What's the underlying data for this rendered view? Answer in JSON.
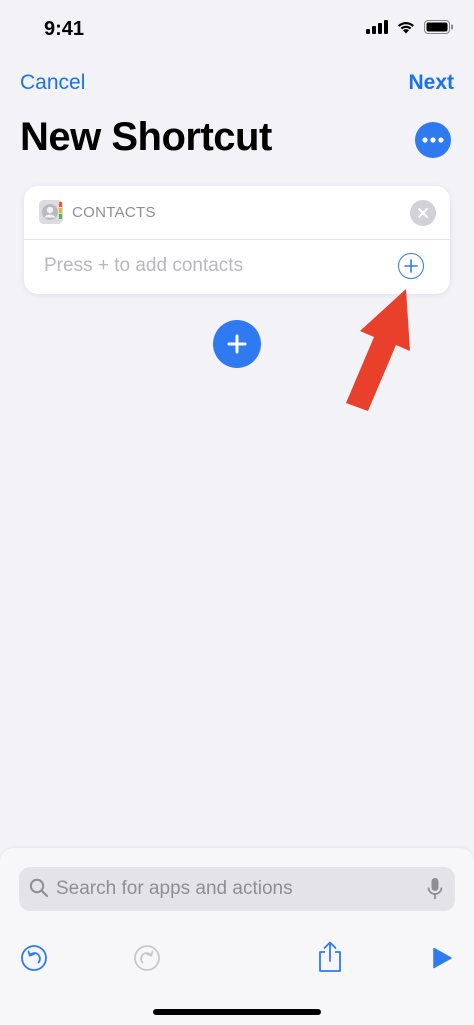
{
  "status_bar": {
    "time": "9:41"
  },
  "nav": {
    "cancel_label": "Cancel",
    "next_label": "Next"
  },
  "page": {
    "title": "New Shortcut"
  },
  "action_card": {
    "title": "CONTACTS",
    "placeholder": "Press + to add contacts"
  },
  "search": {
    "placeholder": "Search for apps and actions"
  },
  "colors": {
    "accent": "#2f7af0",
    "link": "#1a73e8",
    "arrow": "#e8402a",
    "background": "#f2f2f7"
  },
  "icons": [
    "signal-icon",
    "wifi-icon",
    "battery-icon",
    "more-icon",
    "contacts-icon",
    "close-icon",
    "plus-icon",
    "search-icon",
    "microphone-icon",
    "undo-icon",
    "redo-icon",
    "share-icon",
    "play-icon"
  ]
}
